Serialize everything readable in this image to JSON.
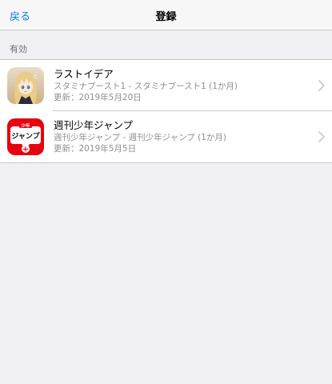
{
  "nav": {
    "back_label": "戻る",
    "title": "登録"
  },
  "section": {
    "header": "有効"
  },
  "subscriptions": [
    {
      "title": "ラストイデア",
      "plan": "スタミナブースト1 - スタミナブースト1 (1か月)",
      "updated": "更新：2019年5月20日",
      "icon": "anime-girl-app-icon"
    },
    {
      "title": "週刊少年ジャンプ",
      "plan": "週刊少年ジャンプ - 週刊少年ジャンプ (1か月)",
      "updated": "更新：2019年5月5日",
      "icon": "shonen-jump-app-icon",
      "icon_text_top": "少年",
      "icon_text_main": "ジャンプ",
      "icon_text_plus": "+"
    }
  ],
  "colors": {
    "accent": "#007aff",
    "background": "#efeff4",
    "jump_red": "#e8000f"
  }
}
